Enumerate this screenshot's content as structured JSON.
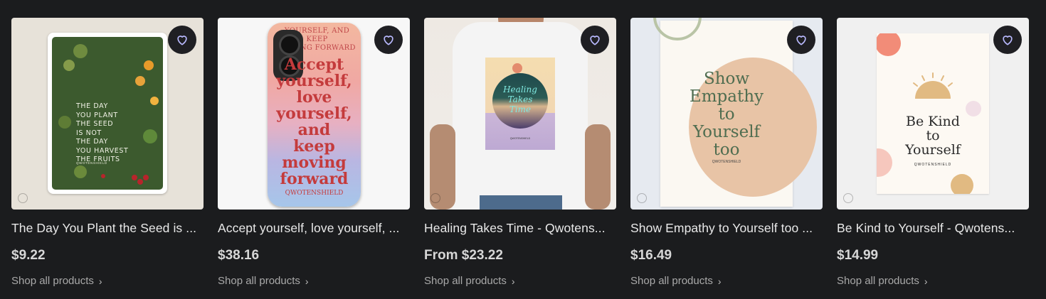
{
  "products": [
    {
      "title": "The Day You Plant the Seed is ...",
      "price": "$9.22",
      "shop_label": "Shop all products",
      "image": {
        "text_lines": [
          "THE DAY",
          "YOU PLANT",
          "THE SEED",
          "IS NOT",
          "THE DAY",
          "YOU HARVEST",
          "THE FRUITS"
        ],
        "brand": "QWOTENSHIELD"
      }
    },
    {
      "title": "Accept yourself, love yourself, ...",
      "price": "$38.16",
      "shop_label": "Shop all products",
      "image": {
        "top_text": "YOURSELF, AND KEEP\nMOVING FORWARD",
        "main_text": "Accept\nyourself,\nlove\nyourself,\nand\nkeep\nmoving\nforward",
        "brand": "QWOTENSHIELD"
      }
    },
    {
      "title": "Healing Takes Time - Qwotens...",
      "price": "From $23.22",
      "shop_label": "Shop all products",
      "image": {
        "text": "Healing\nTakes\nTime",
        "brand": "QWOTENSHIELD"
      }
    },
    {
      "title": "Show Empathy to Yourself too ...",
      "price": "$16.49",
      "shop_label": "Shop all products",
      "image": {
        "text": "Show\nEmpathy\nto\nYourself\ntoo",
        "brand": "QWOTENSHIELD"
      }
    },
    {
      "title": "Be Kind to Yourself - Qwotens...",
      "price": "$14.99",
      "shop_label": "Shop all products",
      "image": {
        "text": "Be Kind\nto\nYourself",
        "brand": "QWOTENSHIELD"
      }
    }
  ],
  "icons": {
    "favorite": "heart-outline-icon",
    "chevron": "chevron-right-icon"
  },
  "colors": {
    "background": "#1b1c1e",
    "fav_button": "#1f1f23",
    "heart_stroke": "#b9b9ff"
  }
}
